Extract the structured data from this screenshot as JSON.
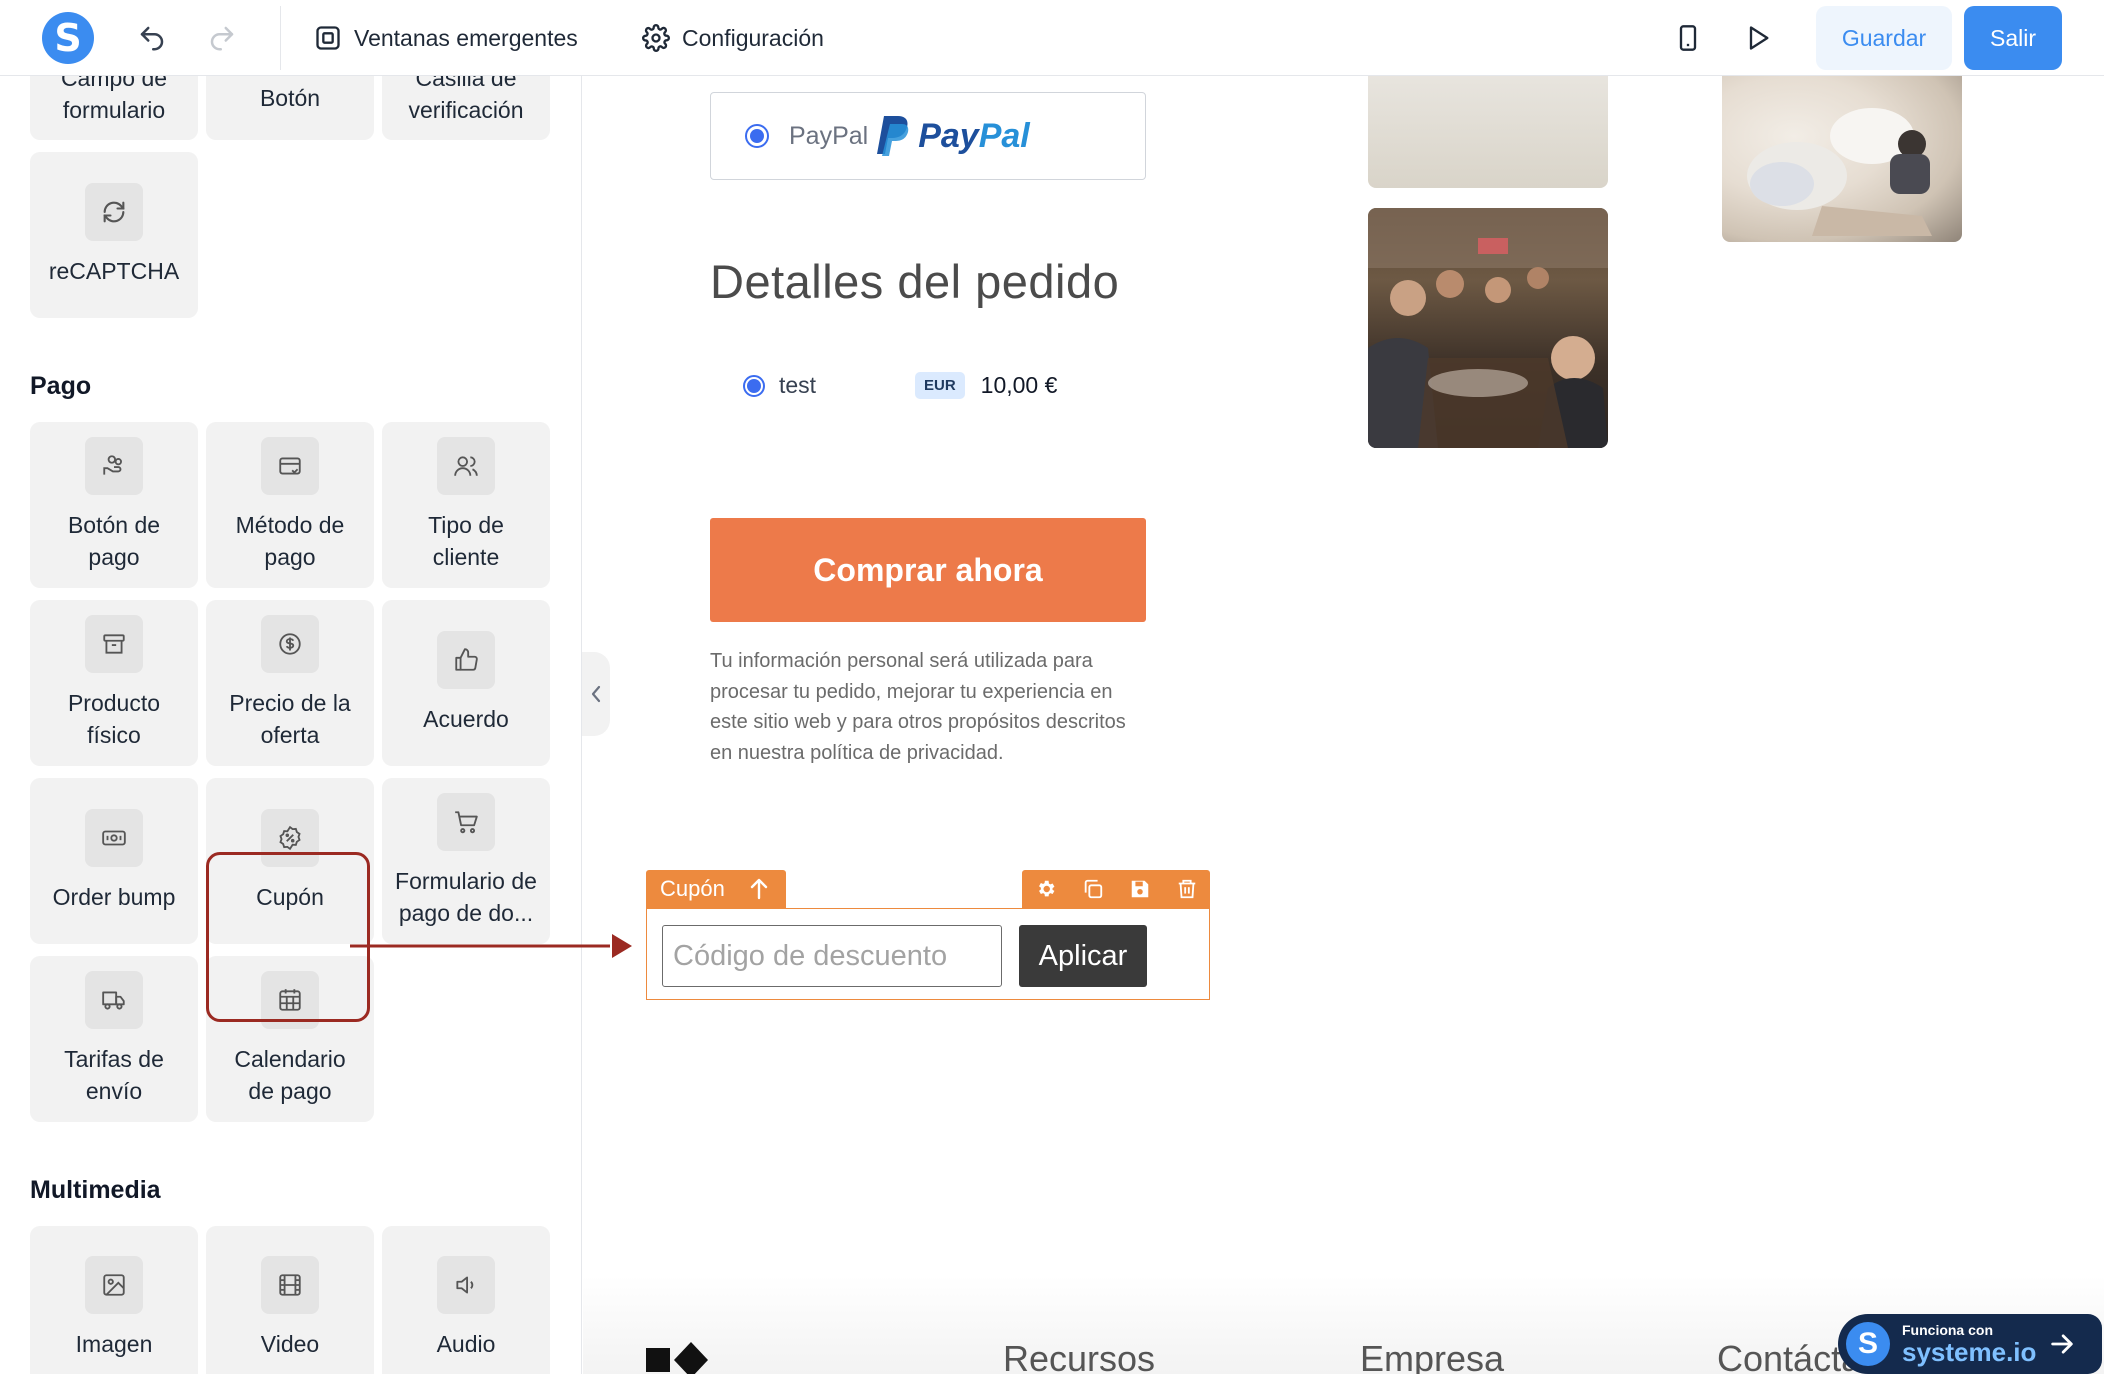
{
  "topbar": {
    "logo_letter": "S",
    "popups_label": "Ventanas emergentes",
    "settings_label": "Configuración",
    "save_label": "Guardar",
    "exit_label": "Salir"
  },
  "sidebar": {
    "top_items": [
      {
        "label": "Campo de formulario"
      },
      {
        "label": "Botón"
      },
      {
        "label": "Casilla de verificación"
      },
      {
        "label": "reCAPTCHA"
      }
    ],
    "payment_section_title": "Pago",
    "payment_items": [
      {
        "label": "Botón de pago",
        "icon": "hand-coins-icon"
      },
      {
        "label": "Método de pago",
        "icon": "credit-card-icon"
      },
      {
        "label": "Tipo de cliente",
        "icon": "users-icon"
      },
      {
        "label": "Producto físico",
        "icon": "box-icon"
      },
      {
        "label": "Precio de la oferta",
        "icon": "dollar-icon"
      },
      {
        "label": "Acuerdo",
        "icon": "thumbs-up-icon"
      },
      {
        "label": "Order bump",
        "icon": "banknote-icon"
      },
      {
        "label": "Cupón",
        "icon": "discount-icon"
      },
      {
        "label": "Formulario de pago de do...",
        "icon": "cart-icon"
      },
      {
        "label": "Tarifas de envío",
        "icon": "truck-icon"
      },
      {
        "label": "Calendario de pago",
        "icon": "calendar-icon"
      }
    ],
    "media_section_title": "Multimedia",
    "media_items": [
      {
        "label": "Imagen",
        "icon": "image-icon"
      },
      {
        "label": "Video",
        "icon": "film-icon"
      },
      {
        "label": "Audio",
        "icon": "speaker-icon"
      }
    ]
  },
  "page": {
    "paypal_label": "PayPal",
    "paypal_logo_text_a": "Pay",
    "paypal_logo_text_b": "Pal",
    "order_title": "Detalles del pedido",
    "product_name": "test",
    "currency_badge": "EUR",
    "product_price": "10,00 €",
    "buy_button": "Comprar ahora",
    "privacy_text": "Tu información personal será utilizada para procesar tu pedido, mejorar tu experiencia en este sitio web y para otros propósitos descritos en nuestra política de privacidad.",
    "coupon_tag": "Cupón",
    "coupon_placeholder": "Código de descuento",
    "coupon_apply": "Aplicar",
    "footer_links": [
      "Recursos",
      "Empresa",
      "Contáctanos"
    ],
    "badge_line1": "Funciona con",
    "badge_line2": "systeme.io"
  },
  "colors": {
    "accent_blue": "#3b8cf0",
    "buy_orange": "#ed7a4a",
    "selection_orange": "#ed8a3e",
    "annotation_red": "#9b2a22"
  }
}
